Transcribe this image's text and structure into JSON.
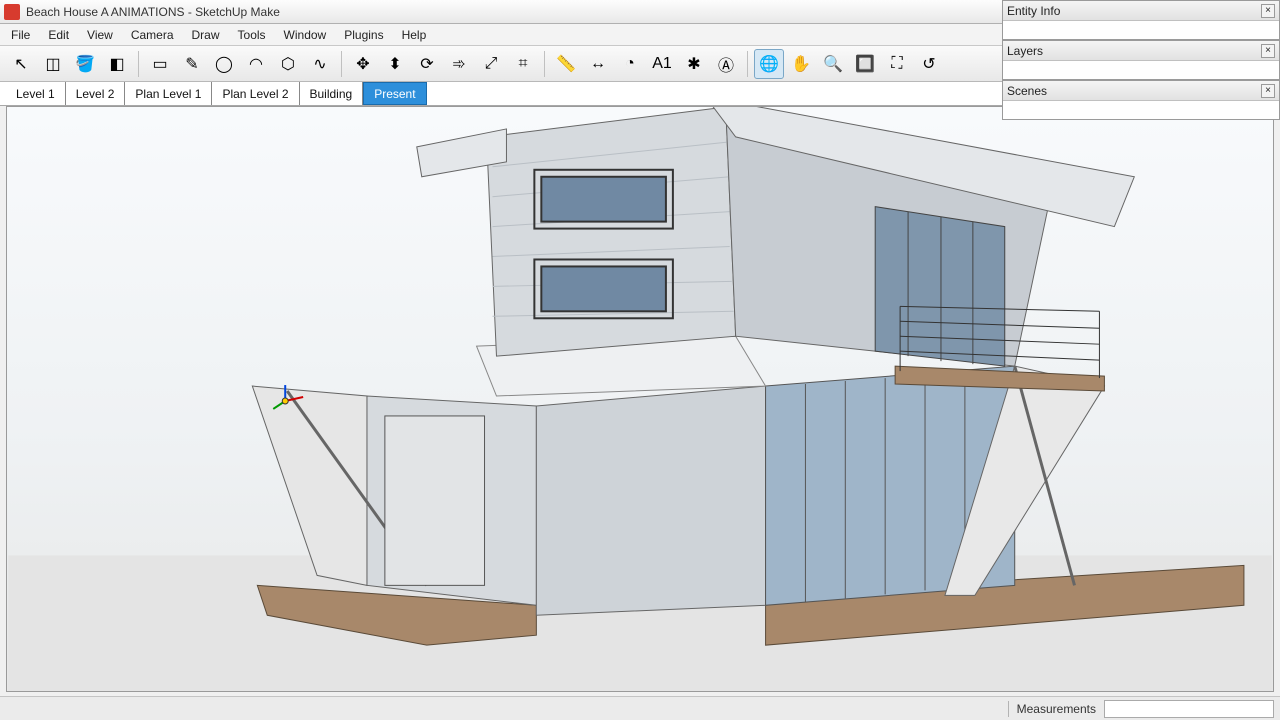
{
  "titlebar": {
    "title": "Beach House A ANIMATIONS - SketchUp Make"
  },
  "menubar": {
    "items": [
      "File",
      "Edit",
      "View",
      "Camera",
      "Draw",
      "Tools",
      "Window",
      "Plugins",
      "Help"
    ]
  },
  "toolbar": {
    "groups": [
      [
        "select-tool",
        "make-component-tool",
        "paint-bucket-tool",
        "eraser-tool"
      ],
      [
        "rectangle-tool",
        "line-tool",
        "circle-tool",
        "arc-tool",
        "polygon-tool",
        "freehand-tool"
      ],
      [
        "move-tool",
        "pushpull-tool",
        "rotate-tool",
        "followme-tool",
        "scale-tool",
        "offset-tool"
      ],
      [
        "tape-measure-tool",
        "dimension-tool",
        "protractor-tool",
        "text-tool",
        "axes-tool",
        "3d-text-tool"
      ],
      [
        "orbit-tool",
        "pan-tool",
        "zoom-tool",
        "zoom-window-tool",
        "zoom-extents-tool",
        "previous-view-tool"
      ]
    ],
    "active": "orbit-tool",
    "icons": {
      "select-tool": "↖",
      "make-component-tool": "◫",
      "paint-bucket-tool": "🪣",
      "eraser-tool": "◧",
      "rectangle-tool": "▭",
      "line-tool": "✎",
      "circle-tool": "◯",
      "arc-tool": "◠",
      "polygon-tool": "⬡",
      "freehand-tool": "∿",
      "move-tool": "✥",
      "pushpull-tool": "⬍",
      "rotate-tool": "⟳",
      "followme-tool": "➾",
      "scale-tool": "⤢",
      "offset-tool": "⌗",
      "tape-measure-tool": "📏",
      "dimension-tool": "↔",
      "protractor-tool": "◔",
      "text-tool": "A1",
      "axes-tool": "✱",
      "3d-text-tool": "Ⓐ",
      "orbit-tool": "🌐",
      "pan-tool": "✋",
      "zoom-tool": "🔍",
      "zoom-window-tool": "🔲",
      "zoom-extents-tool": "⛶",
      "previous-view-tool": "↺"
    }
  },
  "scene_tabs": {
    "items": [
      "Level 1",
      "Level 2",
      "Plan Level 1",
      "Plan Level 2",
      "Building",
      "Present"
    ],
    "active": "Present"
  },
  "panels": {
    "entity_info": "Entity Info",
    "layers": "Layers",
    "scenes": "Scenes"
  },
  "statusbar": {
    "measurements_label": "Measurements"
  }
}
